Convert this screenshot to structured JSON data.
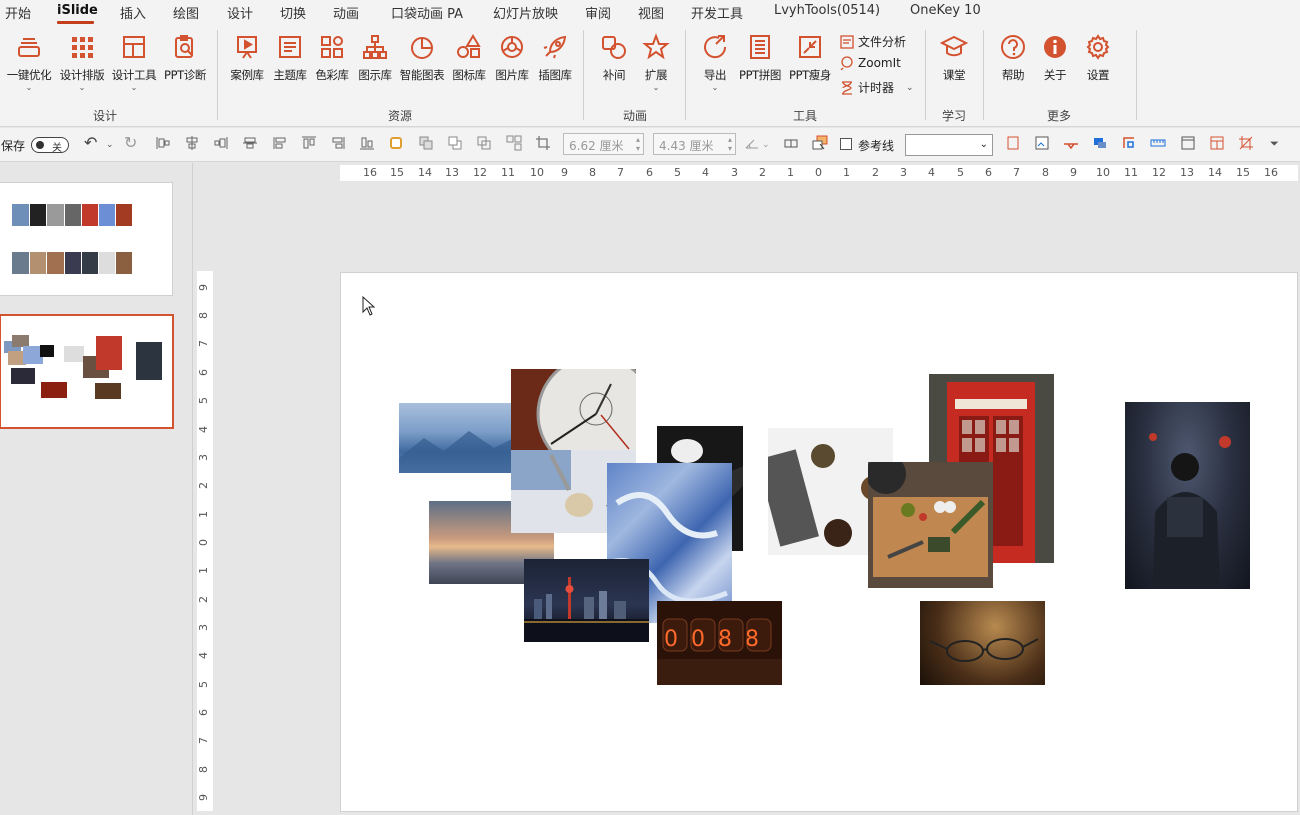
{
  "menu": {
    "tabs": [
      "开始",
      "iSlide",
      "插入",
      "绘图",
      "设计",
      "切换",
      "动画",
      "口袋动画 PA",
      "幻灯片放映",
      "审阅",
      "视图",
      "开发工具",
      "LvyhTools(0514)",
      "OneKey 10"
    ],
    "active": "iSlide"
  },
  "ribbon": {
    "buttons": {
      "b1": "一键优化",
      "b2": "设计排版",
      "b3": "设计工具",
      "b4": "PPT诊断",
      "b5": "案例库",
      "b6": "主题库",
      "b7": "色彩库",
      "b8": "图示库",
      "b9": "智能图表",
      "b10": "图标库",
      "b11": "图片库",
      "b12": "插图库",
      "b13": "补间",
      "b14": "扩展",
      "b15": "导出",
      "b16": "PPT拼图",
      "b17": "PPT瘦身",
      "b18": "课堂",
      "b19": "帮助",
      "b20": "关于",
      "b21": "设置"
    },
    "small": {
      "s1": "文件分析",
      "s2": "ZoomIt",
      "s3": "计时器"
    },
    "groups": {
      "g1": "设计",
      "g2": "资源",
      "g3": "动画",
      "g4": "工具",
      "g5": "学习",
      "g6": "更多"
    }
  },
  "qat": {
    "save_label": "保存",
    "toggle_label": "关",
    "width_value": "6.62 厘米",
    "height_value": "4.43 厘米",
    "guide_label": "参考线",
    "select_value": ""
  },
  "rulers": {
    "h": [
      "16",
      "15",
      "14",
      "13",
      "12",
      "11",
      "10",
      "9",
      "8",
      "7",
      "6",
      "5",
      "4",
      "3",
      "2",
      "1",
      "0",
      "1",
      "2",
      "3",
      "4",
      "5",
      "6",
      "7",
      "8",
      "9",
      "10",
      "11",
      "12",
      "13",
      "14",
      "15",
      "16"
    ],
    "v": [
      "9",
      "8",
      "7",
      "6",
      "5",
      "4",
      "3",
      "2",
      "1",
      "0",
      "1",
      "2",
      "3",
      "4",
      "5",
      "6",
      "7",
      "8",
      "9"
    ]
  },
  "slide": {
    "photos": [
      {
        "name": "photo-mountains",
        "desc": "blue mountains"
      },
      {
        "name": "photo-watch",
        "desc": "stopwatch"
      },
      {
        "name": "photo-mouse",
        "desc": "dark mouse"
      },
      {
        "name": "photo-sunset",
        "desc": "sunset beach"
      },
      {
        "name": "photo-spoon",
        "desc": "spoon with seeds"
      },
      {
        "name": "photo-ice",
        "desc": "blue ice"
      },
      {
        "name": "photo-city",
        "desc": "night city skyline"
      },
      {
        "name": "photo-nixie",
        "desc": "nixie tube counter"
      },
      {
        "name": "photo-desk",
        "desc": "desk flatlay"
      },
      {
        "name": "photo-phonebooth",
        "desc": "red telephone booth"
      },
      {
        "name": "photo-food",
        "desc": "food on cutting board"
      },
      {
        "name": "photo-glasses",
        "desc": "eyeglasses"
      },
      {
        "name": "photo-tunnel",
        "desc": "person in tunnel"
      }
    ],
    "nixie_text": "0088"
  },
  "colors": {
    "accent": "#c43e1c",
    "icon": "#d35230"
  }
}
